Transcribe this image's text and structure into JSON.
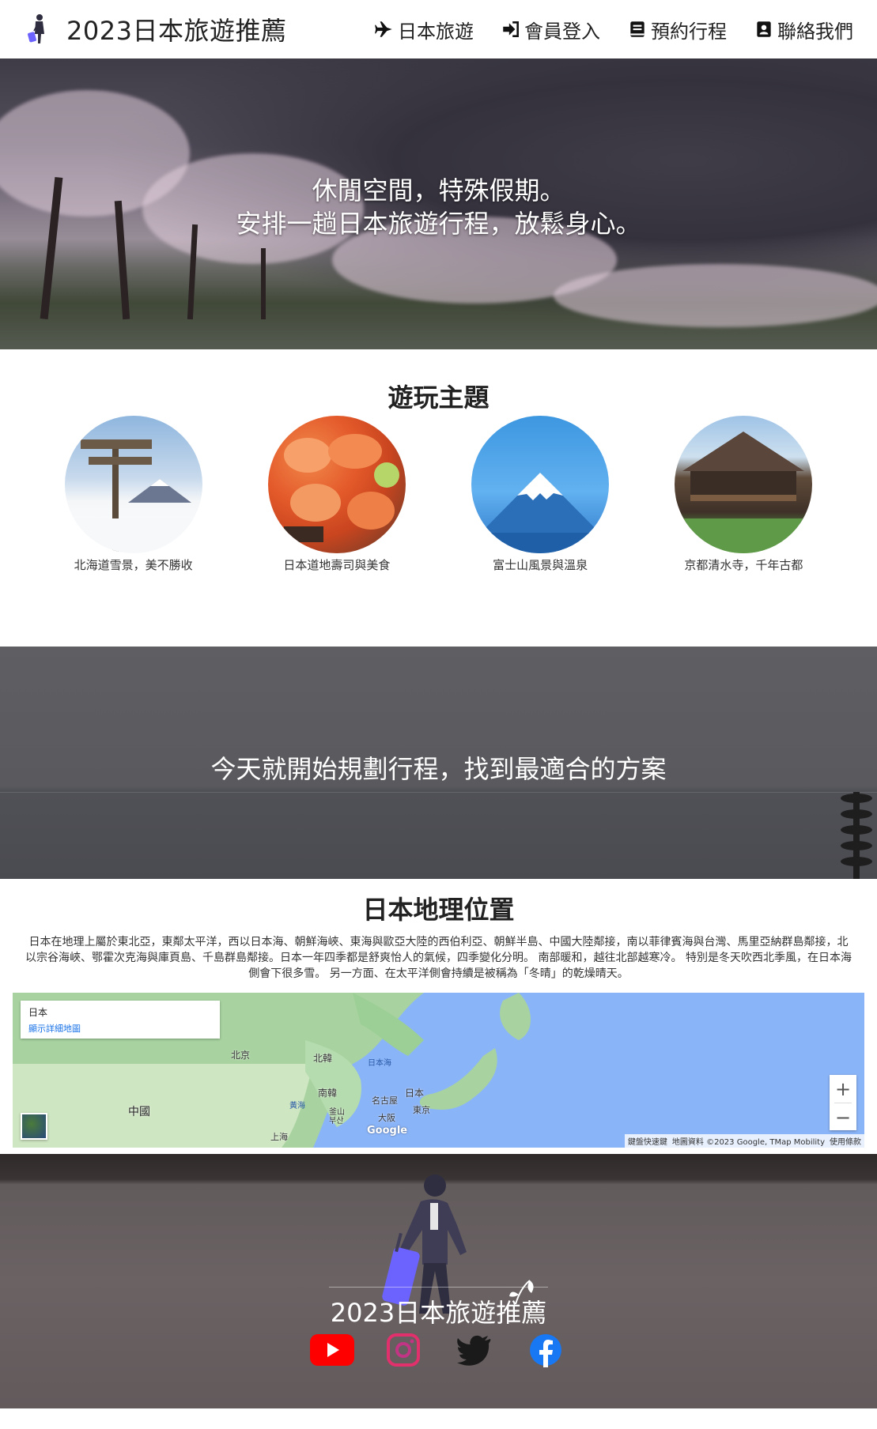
{
  "nav": {
    "brand": "2023日本旅遊推薦",
    "links": [
      {
        "label": "日本旅遊",
        "icon": "plane-icon"
      },
      {
        "label": "會員登入",
        "icon": "sign-in-icon"
      },
      {
        "label": "預約行程",
        "icon": "book-icon"
      },
      {
        "label": "聯絡我們",
        "icon": "contact-card-icon"
      }
    ]
  },
  "hero": {
    "line1": "休閒空間，特殊假期。",
    "line2": "安排一趟日本旅遊行程，放鬆身心。"
  },
  "themes": {
    "title": "遊玩主題",
    "items": [
      {
        "caption": "北海道雪景，美不勝收"
      },
      {
        "caption": "日本道地壽司與美食"
      },
      {
        "caption": "富士山風景與溫泉"
      },
      {
        "caption": "京都清水寺，千年古都"
      }
    ]
  },
  "plan": {
    "text": "今天就開始規劃行程，找到最適合的方案"
  },
  "geo": {
    "title": "日本地理位置",
    "text": "日本在地理上屬於東北亞，東鄰太平洋，西以日本海、朝鮮海峽、東海與歐亞大陸的西伯利亞、朝鮮半島、中國大陸鄰接，南以菲律賓海與台灣、馬里亞納群島鄰接，北以宗谷海峽、鄂霍次克海與庫頁島、千島群島鄰接。日本一年四季都是舒爽怡人的氣候，四季變化分明。 南部暖和，越往北部越寒冷。 特別是冬天吹西北季風，在日本海側會下很多雪。 另一方面、在太平洋側會持續是被稱為「冬晴」的乾燥晴天。"
  },
  "map": {
    "card_title": "日本",
    "card_link": "顯示詳細地圖",
    "labels": {
      "china": "中國",
      "beijing": "北京",
      "north_korea": "北韓",
      "south_korea": "南韓",
      "japan": "日本",
      "sea_of_japan": "日本海",
      "yellow_sea": "黃海",
      "nagoya": "名古屋",
      "tokyo": "東京",
      "osaka": "大阪",
      "busan": "釜山\n부산",
      "shanghai": "上海"
    },
    "zoom_in": "+",
    "zoom_out": "−",
    "google": "Google",
    "footer": {
      "shortcuts": "鍵盤快速鍵",
      "data": "地圖資料 ©2023 Google, TMap Mobility",
      "terms": "使用條款"
    }
  },
  "footer": {
    "title": "2023日本旅遊推薦",
    "socials": [
      "youtube-icon",
      "instagram-icon",
      "twitter-icon",
      "facebook-icon"
    ]
  },
  "colors": {
    "youtube": "#ff0000",
    "instagram": "#e1306c",
    "twitter": "#1a1a1a",
    "facebook": "#1877f2",
    "luggage": "#6c63ff"
  }
}
